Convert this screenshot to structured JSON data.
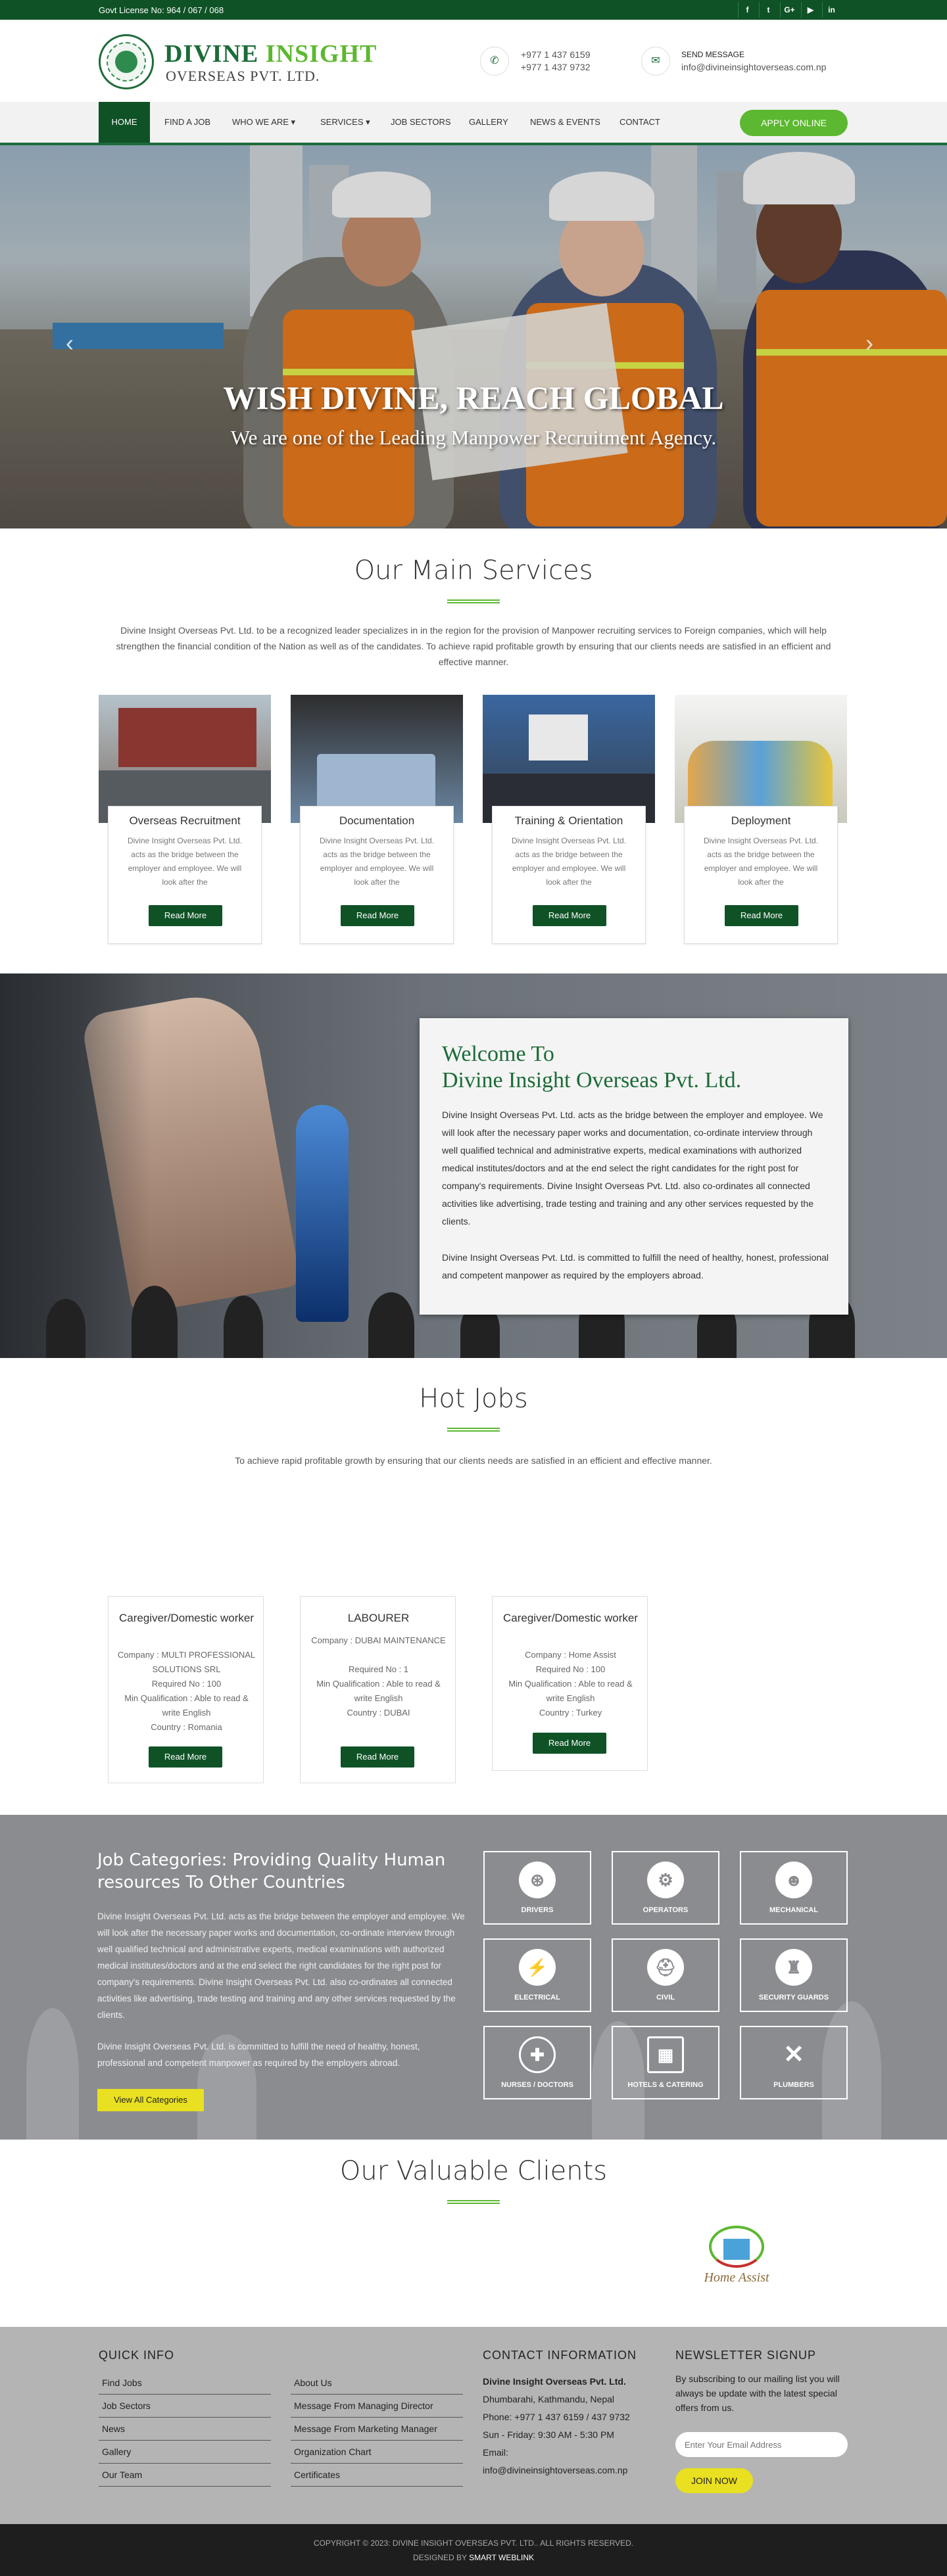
{
  "topbar": {
    "license": "Govt License No: 964 / 067 / 068",
    "social": [
      "f",
      "t",
      "G+",
      "▶",
      "in"
    ]
  },
  "header": {
    "brand_line1a": "DIVINE",
    "brand_line1b": "INSIGHT",
    "brand_line2": "OVERSEAS PVT. LTD.",
    "phone1": "+977 1 437 6159",
    "phone2": "+977 1 437 9732",
    "msg_label": "SEND MESSAGE",
    "email": "info@divineinsightoverseas.com.np"
  },
  "nav": {
    "items": [
      "HOME",
      "FIND A JOB",
      "WHO WE ARE ▾",
      "SERVICES ▾",
      "JOB SECTORS",
      "GALLERY",
      "NEWS & EVENTS",
      "CONTACT"
    ],
    "apply": "APPLY ONLINE"
  },
  "hero": {
    "title": "WISH DIVINE, REACH GLOBAL",
    "subtitle": "We are one of the Leading Manpower Recruitment Agency."
  },
  "services": {
    "heading": "Our Main Services",
    "intro": "Divine Insight Overseas Pvt. Ltd. to be a recognized leader specializes in in the region for the provision of Manpower recruiting services to Foreign companies, which will help strengthen the financial condition of the Nation as well as of the candidates. To achieve rapid profitable growth by ensuring that our clients needs are satisfied in an efficient and effective manner.",
    "cards": [
      {
        "title": "Overseas Recruitment",
        "desc": "Divine Insight Overseas Pvt. Ltd. acts as the bridge between the employer and employee. We will look after the",
        "btn": "Read More"
      },
      {
        "title": "Documentation",
        "desc": "Divine Insight Overseas Pvt. Ltd. acts as the bridge between the employer and employee. We will look after the",
        "btn": "Read More"
      },
      {
        "title": "Training & Orientation",
        "desc": "Divine Insight Overseas Pvt. Ltd. acts as the bridge between the employer and employee. We will look after the",
        "btn": "Read More"
      },
      {
        "title": "Deployment",
        "desc": "Divine Insight Overseas Pvt. Ltd. acts as the bridge between the employer and employee. We will look after the",
        "btn": "Read More"
      }
    ]
  },
  "welcome": {
    "title1": "Welcome To",
    "title2": "Divine Insight Overseas Pvt. Ltd.",
    "p1": "Divine Insight Overseas Pvt. Ltd. acts as the bridge between the employer and employee. We will look after the necessary paper works and documentation, co-ordinate interview through well qualified technical and administrative experts, medical examinations with authorized medical institutes/doctors and at the end select the right candidates for the right post for company's requirements. Divine Insight Overseas Pvt. Ltd. also co-ordinates all connected activities like advertising, trade testing and training and any other services requested by the clients.",
    "p2": "Divine Insight Overseas Pvt. Ltd. is committed to fulfill the need of healthy, honest, professional and competent manpower as required by the employers abroad."
  },
  "hotjobs": {
    "heading": "Hot Jobs",
    "intro": "To achieve rapid profitable growth by ensuring that our clients needs are satisfied in an efficient and effective manner.",
    "jobs": [
      {
        "title": "Caregiver/Domestic worker",
        "company": "Company : MULTI PROFESSIONAL SOLUTIONS SRL",
        "required": "Required No : 100",
        "qual": "Min Qualification : Able to read & write English",
        "country": "Country : Romania",
        "btn": "Read More"
      },
      {
        "title": "LABOURER",
        "company": "Company : DUBAI MAINTENANCE",
        "required": "Required No : 1",
        "qual": "Min Qualification : Able to read & write English",
        "country": "Country : DUBAI",
        "btn": "Read More"
      },
      {
        "title": "Caregiver/Domestic worker",
        "company": "Company : Home Assist",
        "required": "Required No : 100",
        "qual": "Min Qualification : Able to read & write English",
        "country": "Country : Turkey",
        "btn": "Read More"
      }
    ]
  },
  "categories": {
    "title": "Job Categories: Providing Quality Human resources To Other Countries",
    "p1": "Divine Insight Overseas Pvt. Ltd. acts as the bridge between the employer and employee. We will look after the necessary paper works and documentation, co-ordinate interview through well qualified technical and administrative experts, medical examinations with authorized medical institutes/doctors and at the end select the right candidates for the right post for company's requirements. Divine Insight Overseas Pvt. Ltd. also co-ordinates all connected activities like advertising, trade testing and training and any other services requested by the clients.",
    "p2": "Divine Insight Overseas Pvt. Ltd. is committed to fulfill the need of healthy, honest, professional and competent manpower as required by the employers abroad.",
    "btn": "View All Categories",
    "items": [
      {
        "label": "DRIVERS",
        "icon": "steering-icon"
      },
      {
        "label": "OPERATORS",
        "icon": "gear-icon"
      },
      {
        "label": "MECHANICAL",
        "icon": "worker-icon"
      },
      {
        "label": "ELECTRICAL",
        "icon": "electrician-icon"
      },
      {
        "label": "CIVIL",
        "icon": "hardhat-icon"
      },
      {
        "label": "SECURITY GUARDS",
        "icon": "guard-icon"
      },
      {
        "label": "NURSES / DOCTORS",
        "icon": "medical-cross-icon"
      },
      {
        "label": "HOTELS & CATERING",
        "icon": "hotel-icon"
      },
      {
        "label": "PLUMBERS",
        "icon": "wrench-icon"
      }
    ]
  },
  "clients": {
    "heading": "Our Valuable Clients",
    "logo_text": "Home Assist"
  },
  "footer": {
    "quick_heading": "QUICK INFO",
    "col1": [
      "Find Jobs",
      "Job Sectors",
      "News",
      "Gallery",
      "Our Team"
    ],
    "col2": [
      "About Us",
      "Message From Managing Director",
      "Message From Marketing Manager",
      "Organization Chart",
      "Certificates"
    ],
    "contact_heading": "CONTACT INFORMATION",
    "company": "Divine Insight Overseas Pvt. Ltd.",
    "address": "Dhumbarahi, Kathmandu, Nepal",
    "phone": "Phone: +977 1 437 6159 / 437 9732",
    "hours": "Sun - Friday: 9:30 AM - 5:30 PM",
    "email_label": "Email:",
    "email": "info@divineinsightoverseas.com.np",
    "news_heading": "NEWSLETTER SIGNUP",
    "news_text": "By subscribing to our mailing list you will always be update with the latest special offers from us.",
    "news_placeholder": "Enter Your Email Address",
    "join": "JOIN NOW"
  },
  "copyright": {
    "line1": "COPYRIGHT © 2023: DIVINE INSIGHT OVERSEAS PVT. LTD.. ALL RIGHTS RESERVED.",
    "line2a": "DESIGNED BY",
    "line2b": "SMART WEBLINK"
  },
  "colors": {
    "brand_green": "#0f5226",
    "accent_green": "#5cb830",
    "yellow": "#e8e020"
  }
}
